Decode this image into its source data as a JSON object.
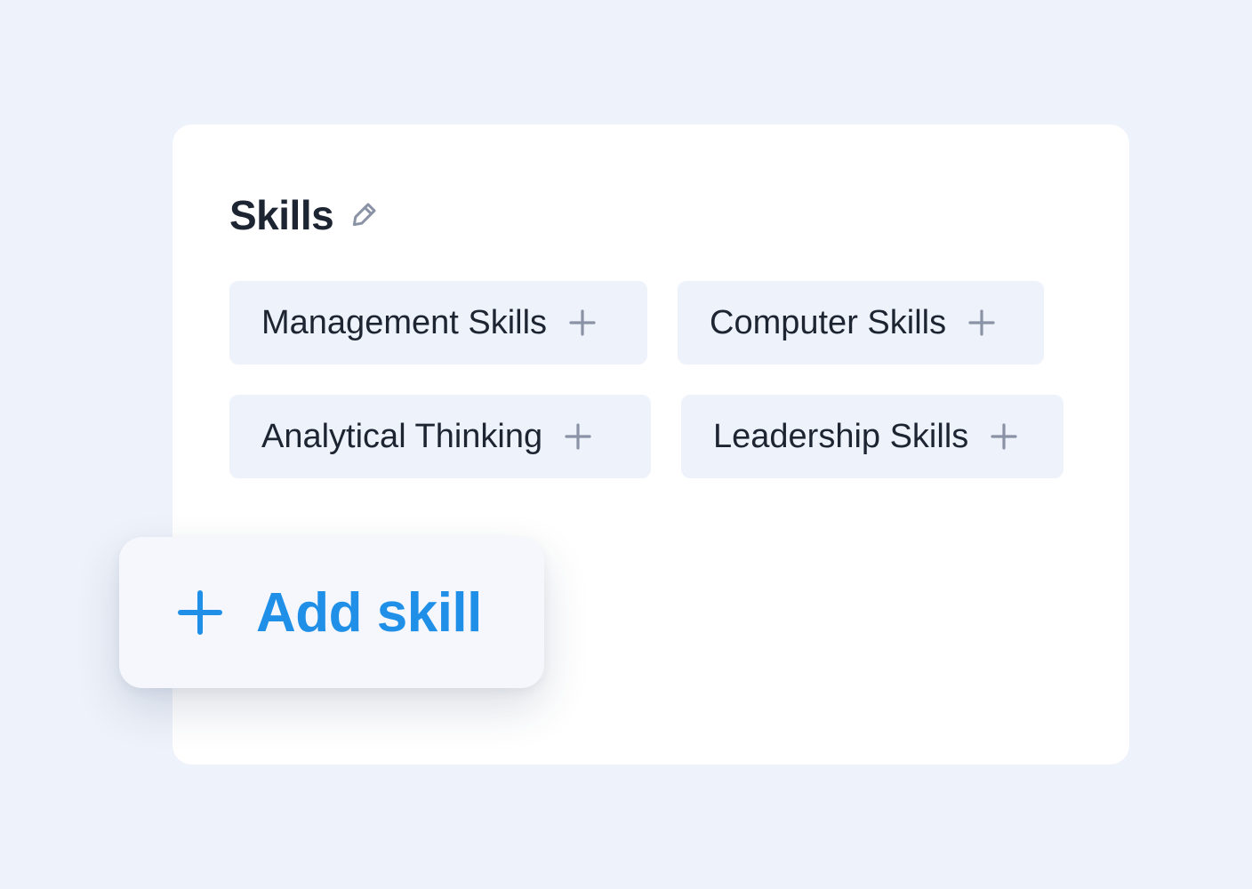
{
  "section": {
    "title": "Skills",
    "edit_icon": "pencil-icon"
  },
  "skills": [
    {
      "label": "Management Skills",
      "icon": "plus-icon"
    },
    {
      "label": "Computer Skills",
      "icon": "plus-icon"
    },
    {
      "label": "Analytical Thinking",
      "icon": "plus-icon"
    },
    {
      "label": "Leadership Skills",
      "icon": "plus-icon"
    }
  ],
  "add_button": {
    "label": "Add skill",
    "icon": "plus-icon"
  },
  "colors": {
    "background": "#EEF2FA",
    "card": "#FFFFFF",
    "chip": "#EEF2FA",
    "text": "#1E2532",
    "icon_gray": "#8A93A6",
    "accent": "#1F8FE8"
  }
}
